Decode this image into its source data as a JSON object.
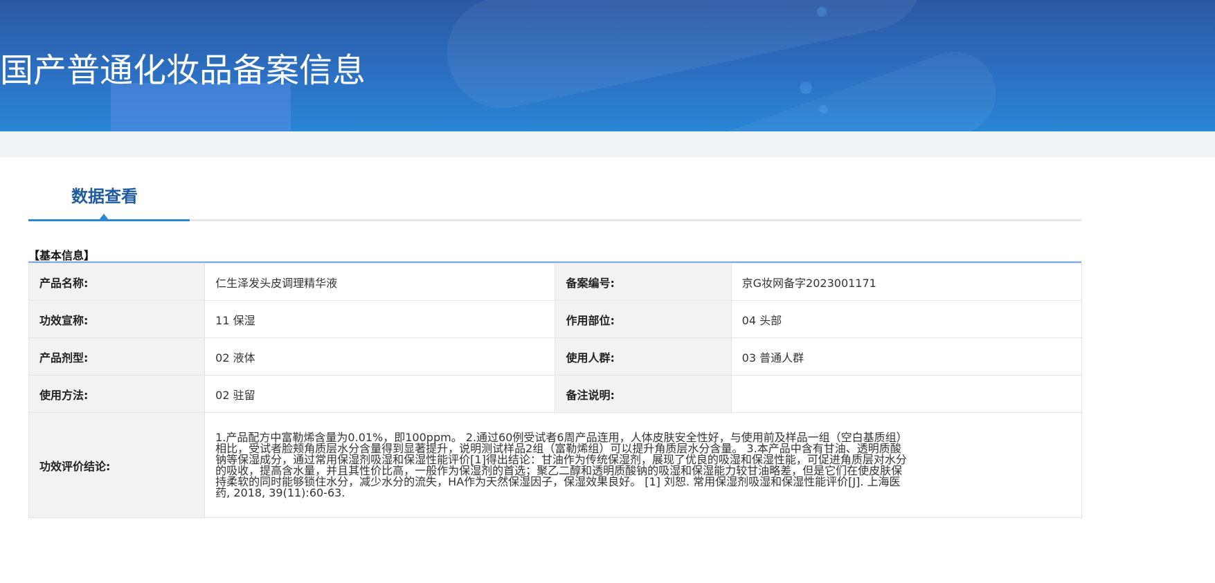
{
  "header": {
    "title": "国产普通化妆品备案信息"
  },
  "tabs": [
    {
      "label": "数据查看",
      "active": true
    }
  ],
  "section": {
    "title": "【基本信息】"
  },
  "colors": {
    "accent": "#2b87d3",
    "tab_text": "#1d5a9e",
    "banner": "#2c6fc1"
  },
  "fields": {
    "product_name": {
      "label": "产品名称:",
      "value": "仁生泽发头皮调理精华液"
    },
    "record_no": {
      "label": "备案编号:",
      "value": "京G妆网备字2023001171"
    },
    "efficacy_claim": {
      "label": "功效宣称:",
      "value": "11 保湿"
    },
    "application_area": {
      "label": "作用部位:",
      "value": "04 头部"
    },
    "dosage_form": {
      "label": "产品剂型:",
      "value": "02 液体"
    },
    "target_group": {
      "label": "使用人群:",
      "value": "03 普通人群"
    },
    "usage": {
      "label": "使用方法:",
      "value": "02 驻留"
    },
    "remarks": {
      "label": "备注说明:",
      "value": ""
    },
    "conclusion": {
      "label": "功效评价结论:",
      "value": "1.产品配方中富勒烯含量为0.01%，即100ppm。 2.通过60例受试者6周产品连用，人体皮肤安全性好，与使用前及样品一组（空白基质组）相比，受试者脸颊角质层水分含量得到显著提升，说明测试样品2组（富勒烯组）可以提升角质层水分含量。 3.本产品中含有甘油、透明质酸钠等保湿成分，通过常用保湿剂吸湿和保湿性能评价[1]得出结论：甘油作为传统保湿剂，展现了优良的吸湿和保湿性能，可促进角质层对水分的吸收，提高含水量，并且其性价比高，一般作为保湿剂的首选；聚乙二醇和透明质酸钠的吸湿和保湿能力较甘油略差，但是它们在使皮肤保持柔软的同时能够锁住水分，减少水分的流失，HA作为天然保湿因子，保湿效果良好。 [1] 刘恕. 常用保湿剂吸湿和保湿性能评价[J]. 上海医药, 2018, 39(11):60-63."
    }
  }
}
